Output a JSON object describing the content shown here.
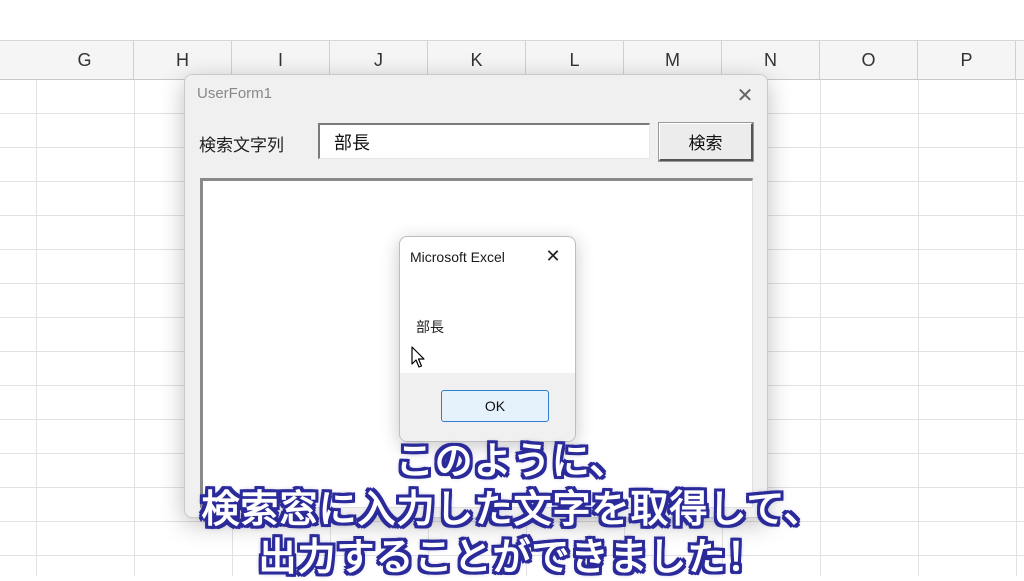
{
  "spreadsheet": {
    "columns": [
      "G",
      "H",
      "I",
      "J",
      "K",
      "L",
      "M",
      "N",
      "O",
      "P"
    ]
  },
  "userform": {
    "title": "UserForm1",
    "label": "検索文字列",
    "search_value": "部長",
    "search_button": "検索",
    "close_glyph": "✕"
  },
  "msgbox": {
    "title": "Microsoft Excel",
    "message": "部長",
    "ok_label": "OK",
    "close_glyph": "✕"
  },
  "captions": {
    "line1": "このように、",
    "line2": "検索窓に入力した文字を取得して、",
    "line3": "出力することができました！"
  },
  "colors": {
    "caption_outline": "#2b2a9a",
    "ok_border": "#2f7fd0",
    "ok_fill": "#e5f1fb"
  }
}
